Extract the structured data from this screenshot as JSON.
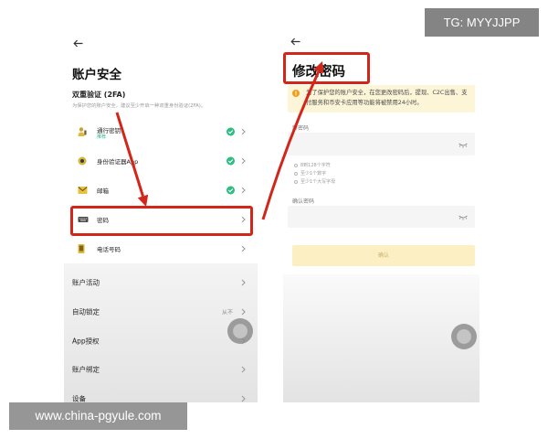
{
  "watermarks": {
    "top": "TG: MYYJJPP",
    "bottom": "www.china-pgyule.com"
  },
  "left_screen": {
    "back_icon": "arrow-left-icon",
    "title": "账户安全",
    "two_fa": {
      "title": "双重验证 (2FA)",
      "description": "为保护您的账户安全，建议至少开启一种双重身份验证(2FA)。"
    },
    "security_items": [
      {
        "label": "通行密钥",
        "tag": "推荐",
        "icon": "passkey-icon",
        "status_icon": "check-circle-icon"
      },
      {
        "label": "身份验证器App",
        "icon": "authenticator-icon",
        "status_icon": "check-circle-icon"
      },
      {
        "label": "邮箱",
        "icon": "email-icon",
        "status_icon": "check-circle-icon"
      },
      {
        "label": "密码",
        "icon": "password-icon"
      },
      {
        "label": "电话号码",
        "icon": "phone-icon"
      }
    ],
    "menu_items": [
      {
        "label": "账户活动"
      },
      {
        "label": "自动锁定",
        "value": "从不"
      },
      {
        "label": "App授权"
      },
      {
        "label": "账户绑定"
      },
      {
        "label": "设备"
      }
    ]
  },
  "right_screen": {
    "back_icon": "arrow-left-icon",
    "title": "修改密码",
    "notice": {
      "icon": "warning-icon",
      "text": "为了保护您的账户安全，在您更改密码后，提现、C2C出售、支付服务和币安卡应用等功能将被禁用24小时。"
    },
    "new_password": {
      "label": "新密码",
      "value": "",
      "icon": "eye-off-icon"
    },
    "password_rules": [
      "8到128个字符",
      "至少1个数字",
      "至少1个大写字母"
    ],
    "confirm_password": {
      "label": "确认密码",
      "value": "",
      "icon": "eye-off-icon"
    },
    "confirm_button": "确认"
  },
  "colors": {
    "annotation_red": "#d3261b",
    "success_green": "#2ebd85",
    "notice_bg": "#fdf5d8",
    "button_disabled_bg": "#fcefc3",
    "accent_yellow": "#e0b93a"
  }
}
